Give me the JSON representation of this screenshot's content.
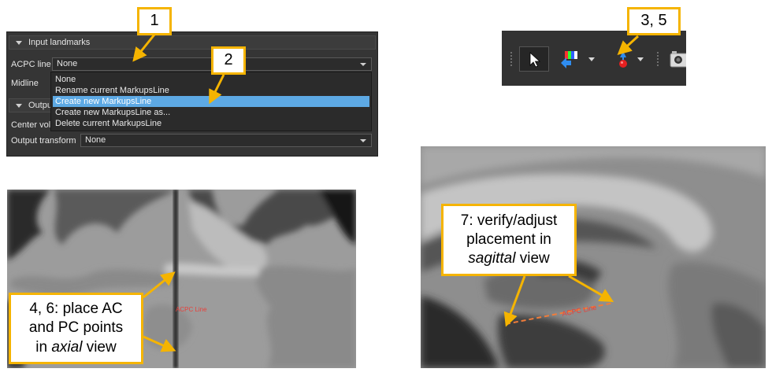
{
  "colors": {
    "callout_border": "#f5b400",
    "arrow": "#f5b400",
    "selection": "#5da9e4",
    "line_label": "#e8403b",
    "panel_bg": "#353535"
  },
  "panel": {
    "section_input": "Input landmarks",
    "acpc_label": "ACPC line",
    "acpc_value": "None",
    "midline_label": "Midline",
    "section_output": "Outpu",
    "center_label": "Center vol",
    "output_transform_label": "Output transform",
    "output_transform_value": "None"
  },
  "dropdown": {
    "options": [
      "None",
      "Rename current MarkupsLine",
      "Create new MarkupsLine",
      "Create new MarkupsLine as...",
      "Delete current MarkupsLine"
    ],
    "selected_index": 2
  },
  "toolbar": {
    "icons": [
      "select-arrow-icon",
      "color-picker-icon",
      "place-fiducial-icon",
      "screenshot-icon"
    ]
  },
  "callouts": {
    "c1": "1",
    "c2": "2",
    "c35": "3, 5",
    "c46": {
      "line1": "4, 6: place AC",
      "line2": "and PC points",
      "line3_pre": "in ",
      "line3_em": "axial",
      "line3_post": " view"
    },
    "c7": {
      "line1": "7: verify/adjust",
      "line2": "placement in",
      "line3_em": "sagittal",
      "line3_post": " view"
    }
  },
  "images": {
    "axial_label": "ACPC Line",
    "sagittal_label": "ACPC Line"
  }
}
